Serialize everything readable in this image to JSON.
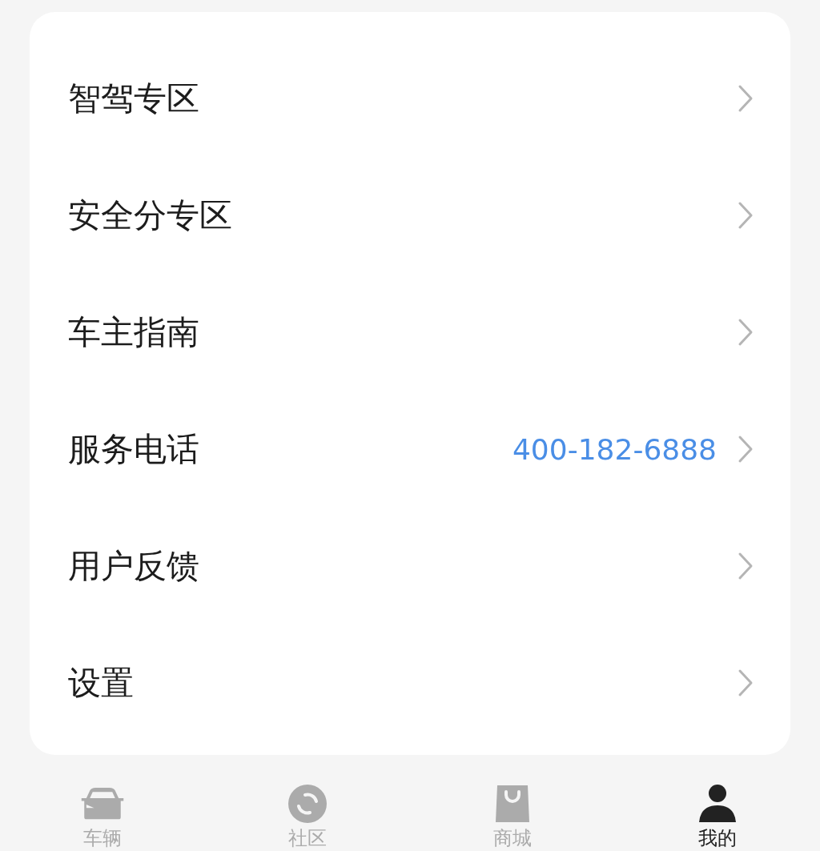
{
  "menu": [
    {
      "label": "智驾专区"
    },
    {
      "label": "安全分专区"
    },
    {
      "label": "车主指南"
    },
    {
      "label": "服务电话",
      "value": "400-182-6888"
    },
    {
      "label": "用户反馈"
    },
    {
      "label": "设置"
    }
  ],
  "tabs": [
    {
      "label": "车辆",
      "kind": "car",
      "selected": false
    },
    {
      "label": "社区",
      "kind": "community",
      "selected": false
    },
    {
      "label": "商城",
      "kind": "shop",
      "selected": false
    },
    {
      "label": "我的",
      "kind": "profile",
      "selected": true
    }
  ]
}
